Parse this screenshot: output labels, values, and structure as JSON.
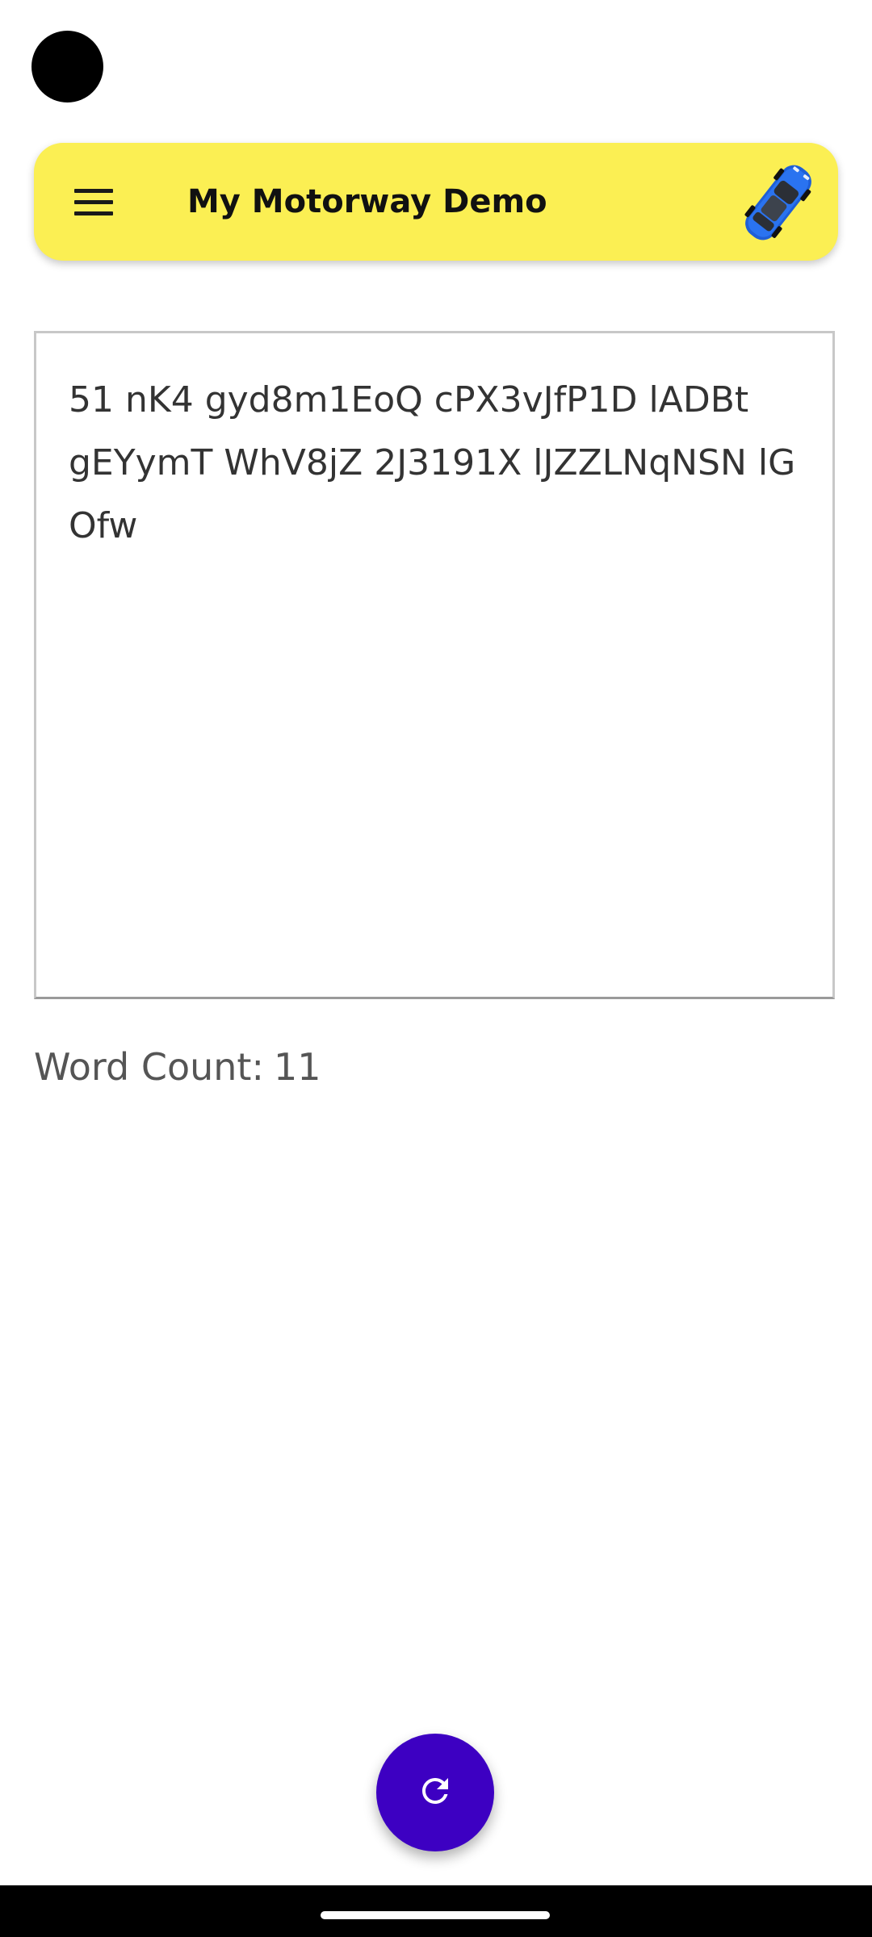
{
  "app_bar": {
    "title": "My Motorway Demo",
    "background_color": "#FBEF53",
    "menu_icon": "hamburger-menu-icon",
    "car_icon": "blue-car-icon"
  },
  "editor": {
    "text": "51 nK4 gyd8m1EoQ cPX3vJfP1D lADBt gEYymT WhV8jZ 2J3191X lJZZLNqNSN lG Ofw"
  },
  "word_count": {
    "label": "Word Count:",
    "value": "11"
  },
  "fab": {
    "icon": "refresh-icon",
    "color": "#3D00C2"
  },
  "system": {
    "camera_cutout": "camera-cutout",
    "nav_handle": "home-indicator"
  }
}
